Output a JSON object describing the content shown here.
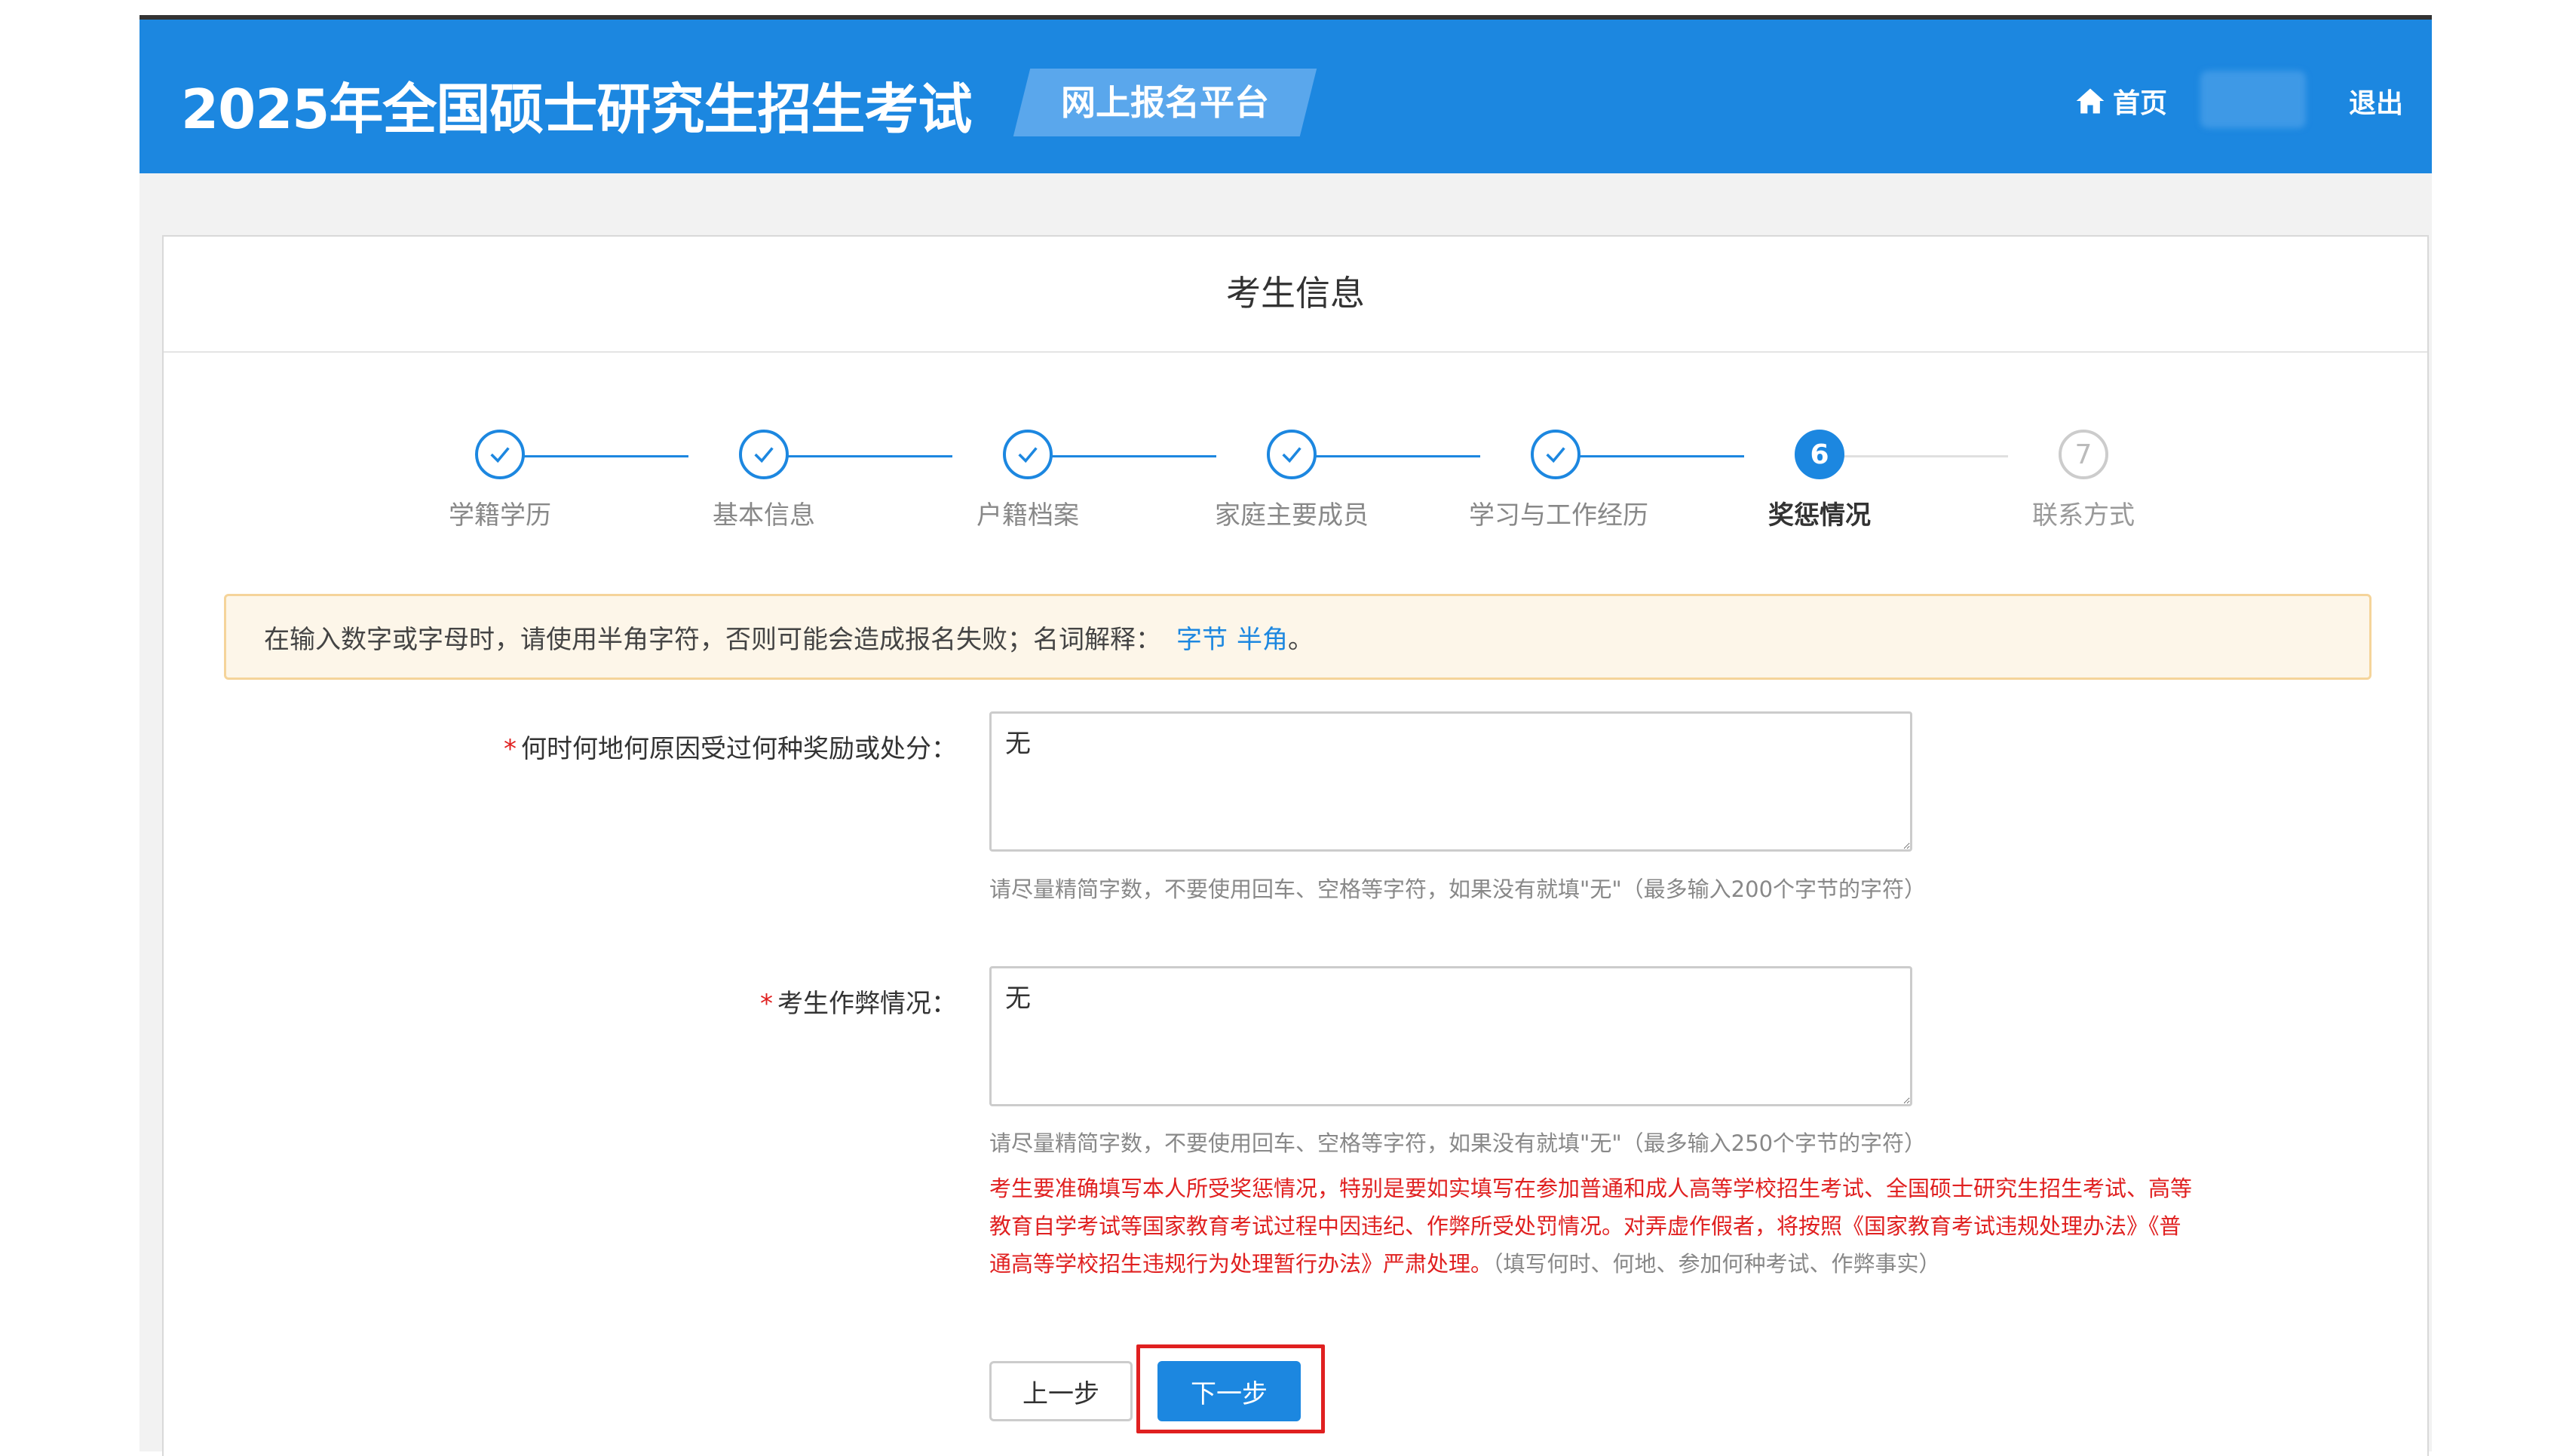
{
  "header": {
    "title": "2025年全国硕士研究生招生考试",
    "platform": "网上报名平台",
    "home_label": "首页",
    "logout_label": "退出",
    "home_icon": "home-icon"
  },
  "card": {
    "title": "考生信息"
  },
  "steps": [
    {
      "number": "1",
      "label": "学籍学历",
      "state": "done"
    },
    {
      "number": "2",
      "label": "基本信息",
      "state": "done"
    },
    {
      "number": "3",
      "label": "户籍档案",
      "state": "done"
    },
    {
      "number": "4",
      "label": "家庭主要成员",
      "state": "done"
    },
    {
      "number": "5",
      "label": "学习与工作经历",
      "state": "done"
    },
    {
      "number": "6",
      "label": "奖惩情况",
      "state": "active"
    },
    {
      "number": "7",
      "label": "联系方式",
      "state": "todo"
    }
  ],
  "notice": {
    "text": "在输入数字或字母时，请使用半角字符，否则可能会造成报名失败；名词解释：",
    "link_byte": "字节",
    "link_halfwidth": "半角",
    "suffix": "。"
  },
  "form": {
    "reward_label": "何时何地何原因受过何种奖励或处分：",
    "reward_value": "无",
    "reward_hint": "请尽量精简字数，不要使用回车、空格等字符，如果没有就填\"无\"（最多输入200个字节的字符）",
    "cheat_label": "考生作弊情况：",
    "cheat_value": "无",
    "cheat_hint": "请尽量精简字数，不要使用回车、空格等字符，如果没有就填\"无\"（最多输入250个字节的字符）",
    "warning": "考生要准确填写本人所受奖惩情况，特别是要如实填写在参加普通和成人高等学校招生考试、全国硕士研究生招生考试、高等教育自学考试等国家教育考试过程中因违纪、作弊所受处罚情况。对弄虚作假者，将按照《国家教育考试违规处理办法》《普通高等学校招生违规行为处理暂行办法》严肃处理。",
    "warning_note": "（填写何时、何地、参加何种考试、作弊事实）",
    "required_mark": "*"
  },
  "buttons": {
    "prev": "上一步",
    "next": "下一步"
  },
  "colors": {
    "brand": "#1c87e0",
    "warning": "#e02020",
    "notice_bg": "#fdf6e9",
    "notice_border": "#f5d49a"
  }
}
